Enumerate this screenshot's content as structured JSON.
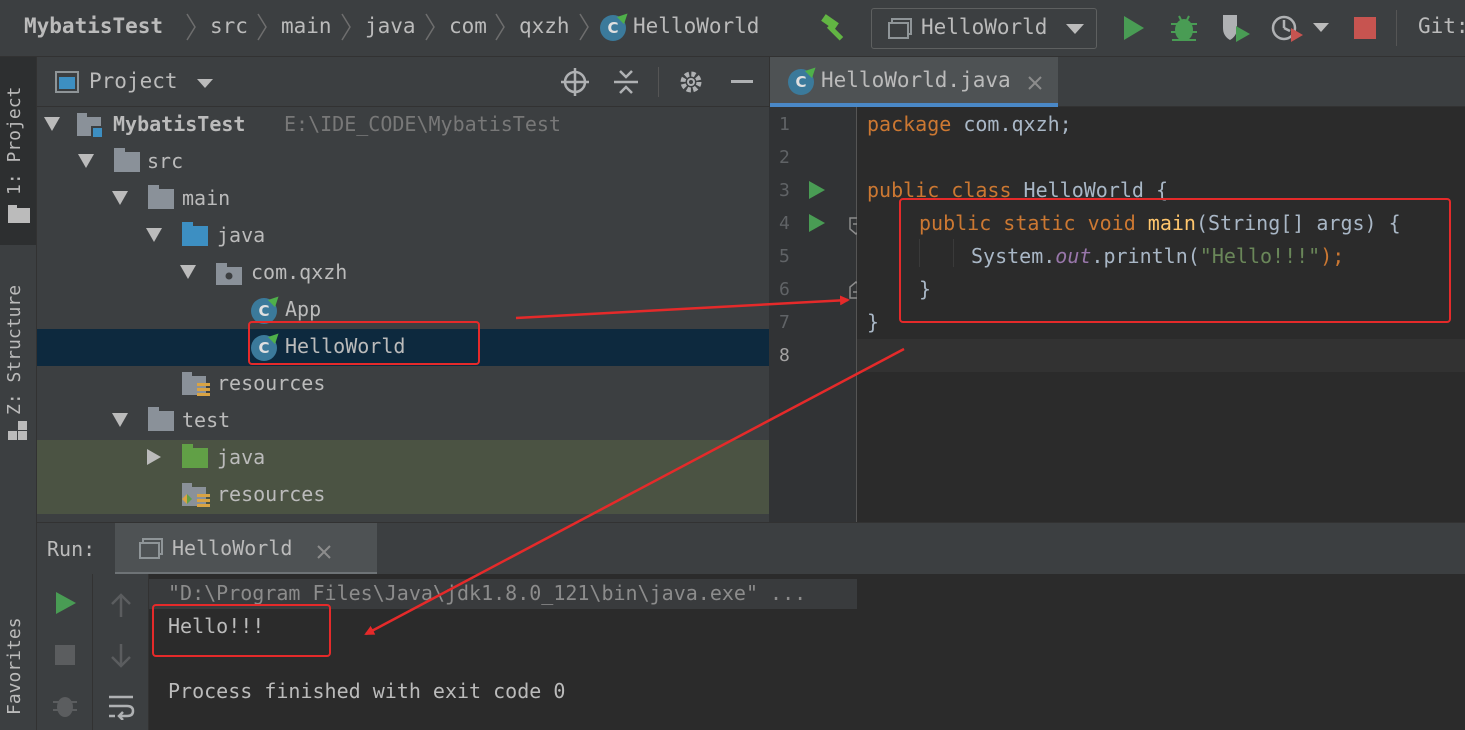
{
  "navbar": {
    "breadcrumbs": [
      "MybatisTest",
      "src",
      "main",
      "java",
      "com",
      "qxzh",
      "HelloWorld"
    ],
    "run_config": "HelloWorld",
    "vcs_label": "Git:"
  },
  "left_strip": {
    "project_label": "1: Project",
    "structure_label": "Z: Structure",
    "favorites_label": "Favorites"
  },
  "project": {
    "header": "Project",
    "root_name": "MybatisTest",
    "root_path": "E:\\IDE_CODE\\MybatisTest",
    "tree": [
      {
        "label": "src"
      },
      {
        "label": "main"
      },
      {
        "label": "java"
      },
      {
        "label": "com.qxzh"
      },
      {
        "label": "App"
      },
      {
        "label": "HelloWorld"
      },
      {
        "label": "resources"
      },
      {
        "label": "test"
      },
      {
        "label": "java"
      },
      {
        "label": "resources"
      }
    ]
  },
  "editor": {
    "tab": "HelloWorld.java",
    "line_numbers": [
      "1",
      "2",
      "3",
      "4",
      "5",
      "6",
      "7",
      "8"
    ],
    "code": {
      "l1_kw": "package",
      "l1_rest": " com.qxzh;",
      "l3_kw": "public class",
      "l3_rest": " HelloWorld {",
      "l4_kw": "public static void",
      "l4_fn": "main",
      "l4_rest": "(String[] args) {",
      "l5_a": "System.",
      "l5_field": "out",
      "l5_b": ".println(",
      "l5_str": "\"Hello!!!\"",
      "l5_c": ");",
      "l6": "}",
      "l7": "}"
    }
  },
  "run": {
    "label": "Run:",
    "tab": "HelloWorld",
    "console": {
      "command": "\"D:\\Program Files\\Java\\jdk1.8.0_121\\bin\\java.exe\" ...",
      "output": "Hello!!!",
      "exit": "Process finished with exit code 0"
    }
  },
  "colors": {
    "annotation": "#e52a2a",
    "keyword": "#cc7832",
    "string": "#6a8759",
    "function": "#ffc66d"
  }
}
